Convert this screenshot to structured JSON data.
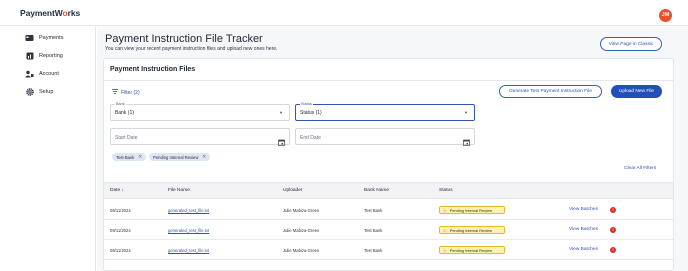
{
  "app": {
    "brand_main": "PaymentW",
    "brand_accent": "o",
    "brand_tail": "rks",
    "avatar_initials": "JM"
  },
  "sidebar": {
    "items": [
      {
        "label": "Payments",
        "icon": "payments-icon"
      },
      {
        "label": "Reporting",
        "icon": "reporting-icon"
      },
      {
        "label": "Account",
        "icon": "account-icon"
      },
      {
        "label": "Setup",
        "icon": "setup-icon"
      }
    ]
  },
  "page": {
    "title": "Payment Instruction File Tracker",
    "subtitle": "You can view your recent payment instruction files and upload new ones here.",
    "view_classic_label": "View Page in Classic"
  },
  "card": {
    "title": "Payment Instruction Files",
    "filter_toggle": "Filter (2)",
    "generate_test_label": "Generate Test Payment Instruction File",
    "upload_label": "Upload New File",
    "clear_all_label": "Clear All Filters"
  },
  "filters": {
    "bank": {
      "label": "Bank",
      "value": "Bank (1)"
    },
    "status": {
      "label": "Status",
      "value": "Status (1)"
    },
    "start_date": {
      "placeholder": "Start Date"
    },
    "end_date": {
      "placeholder": "End Date"
    },
    "chips": [
      "Test Bank",
      "Pending Internal Review"
    ]
  },
  "table": {
    "headers": {
      "date": "Date ↓",
      "file_name": "File Name",
      "uploader": "Uploader",
      "bank_name": "Bank Name",
      "status": "Status"
    },
    "rows": [
      {
        "date": "09/11/2024",
        "file_name": "generated_test_file.txt",
        "uploader": "Julie Mabiza-Green",
        "bank_name": "Test Bank",
        "status": "Pending Internal Review",
        "action": "View Batches",
        "error": "!"
      },
      {
        "date": "09/11/2024",
        "file_name": "generated_test_file.txt",
        "uploader": "Julie Mabiza-Green",
        "bank_name": "Test Bank",
        "status": "Pending Internal Review",
        "action": "View Batches",
        "error": "!"
      },
      {
        "date": "09/11/2024",
        "file_name": "generated_test_file.txt",
        "uploader": "Julie Mabiza-Green",
        "bank_name": "Test Bank",
        "status": "Pending Internal Review",
        "action": "View Batches",
        "error": "!"
      }
    ]
  },
  "colors": {
    "accent": "#2350b8",
    "brand_orange": "#e8512a",
    "status_pending_bg": "#fff0b3",
    "error_red": "#d93025"
  }
}
